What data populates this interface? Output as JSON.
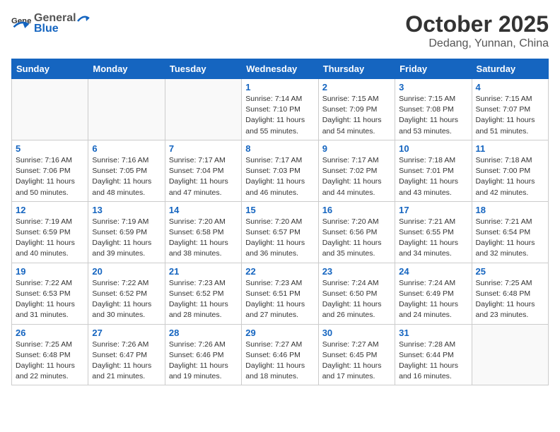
{
  "header": {
    "logo_general": "General",
    "logo_blue": "Blue",
    "title": "October 2025",
    "subtitle": "Dedang, Yunnan, China"
  },
  "weekdays": [
    "Sunday",
    "Monday",
    "Tuesday",
    "Wednesday",
    "Thursday",
    "Friday",
    "Saturday"
  ],
  "weeks": [
    [
      {
        "day": "",
        "sunrise": "",
        "sunset": "",
        "daylight": ""
      },
      {
        "day": "",
        "sunrise": "",
        "sunset": "",
        "daylight": ""
      },
      {
        "day": "",
        "sunrise": "",
        "sunset": "",
        "daylight": ""
      },
      {
        "day": "1",
        "sunrise": "Sunrise: 7:14 AM",
        "sunset": "Sunset: 7:10 PM",
        "daylight": "Daylight: 11 hours and 55 minutes."
      },
      {
        "day": "2",
        "sunrise": "Sunrise: 7:15 AM",
        "sunset": "Sunset: 7:09 PM",
        "daylight": "Daylight: 11 hours and 54 minutes."
      },
      {
        "day": "3",
        "sunrise": "Sunrise: 7:15 AM",
        "sunset": "Sunset: 7:08 PM",
        "daylight": "Daylight: 11 hours and 53 minutes."
      },
      {
        "day": "4",
        "sunrise": "Sunrise: 7:15 AM",
        "sunset": "Sunset: 7:07 PM",
        "daylight": "Daylight: 11 hours and 51 minutes."
      }
    ],
    [
      {
        "day": "5",
        "sunrise": "Sunrise: 7:16 AM",
        "sunset": "Sunset: 7:06 PM",
        "daylight": "Daylight: 11 hours and 50 minutes."
      },
      {
        "day": "6",
        "sunrise": "Sunrise: 7:16 AM",
        "sunset": "Sunset: 7:05 PM",
        "daylight": "Daylight: 11 hours and 48 minutes."
      },
      {
        "day": "7",
        "sunrise": "Sunrise: 7:17 AM",
        "sunset": "Sunset: 7:04 PM",
        "daylight": "Daylight: 11 hours and 47 minutes."
      },
      {
        "day": "8",
        "sunrise": "Sunrise: 7:17 AM",
        "sunset": "Sunset: 7:03 PM",
        "daylight": "Daylight: 11 hours and 46 minutes."
      },
      {
        "day": "9",
        "sunrise": "Sunrise: 7:17 AM",
        "sunset": "Sunset: 7:02 PM",
        "daylight": "Daylight: 11 hours and 44 minutes."
      },
      {
        "day": "10",
        "sunrise": "Sunrise: 7:18 AM",
        "sunset": "Sunset: 7:01 PM",
        "daylight": "Daylight: 11 hours and 43 minutes."
      },
      {
        "day": "11",
        "sunrise": "Sunrise: 7:18 AM",
        "sunset": "Sunset: 7:00 PM",
        "daylight": "Daylight: 11 hours and 42 minutes."
      }
    ],
    [
      {
        "day": "12",
        "sunrise": "Sunrise: 7:19 AM",
        "sunset": "Sunset: 6:59 PM",
        "daylight": "Daylight: 11 hours and 40 minutes."
      },
      {
        "day": "13",
        "sunrise": "Sunrise: 7:19 AM",
        "sunset": "Sunset: 6:59 PM",
        "daylight": "Daylight: 11 hours and 39 minutes."
      },
      {
        "day": "14",
        "sunrise": "Sunrise: 7:20 AM",
        "sunset": "Sunset: 6:58 PM",
        "daylight": "Daylight: 11 hours and 38 minutes."
      },
      {
        "day": "15",
        "sunrise": "Sunrise: 7:20 AM",
        "sunset": "Sunset: 6:57 PM",
        "daylight": "Daylight: 11 hours and 36 minutes."
      },
      {
        "day": "16",
        "sunrise": "Sunrise: 7:20 AM",
        "sunset": "Sunset: 6:56 PM",
        "daylight": "Daylight: 11 hours and 35 minutes."
      },
      {
        "day": "17",
        "sunrise": "Sunrise: 7:21 AM",
        "sunset": "Sunset: 6:55 PM",
        "daylight": "Daylight: 11 hours and 34 minutes."
      },
      {
        "day": "18",
        "sunrise": "Sunrise: 7:21 AM",
        "sunset": "Sunset: 6:54 PM",
        "daylight": "Daylight: 11 hours and 32 minutes."
      }
    ],
    [
      {
        "day": "19",
        "sunrise": "Sunrise: 7:22 AM",
        "sunset": "Sunset: 6:53 PM",
        "daylight": "Daylight: 11 hours and 31 minutes."
      },
      {
        "day": "20",
        "sunrise": "Sunrise: 7:22 AM",
        "sunset": "Sunset: 6:52 PM",
        "daylight": "Daylight: 11 hours and 30 minutes."
      },
      {
        "day": "21",
        "sunrise": "Sunrise: 7:23 AM",
        "sunset": "Sunset: 6:52 PM",
        "daylight": "Daylight: 11 hours and 28 minutes."
      },
      {
        "day": "22",
        "sunrise": "Sunrise: 7:23 AM",
        "sunset": "Sunset: 6:51 PM",
        "daylight": "Daylight: 11 hours and 27 minutes."
      },
      {
        "day": "23",
        "sunrise": "Sunrise: 7:24 AM",
        "sunset": "Sunset: 6:50 PM",
        "daylight": "Daylight: 11 hours and 26 minutes."
      },
      {
        "day": "24",
        "sunrise": "Sunrise: 7:24 AM",
        "sunset": "Sunset: 6:49 PM",
        "daylight": "Daylight: 11 hours and 24 minutes."
      },
      {
        "day": "25",
        "sunrise": "Sunrise: 7:25 AM",
        "sunset": "Sunset: 6:48 PM",
        "daylight": "Daylight: 11 hours and 23 minutes."
      }
    ],
    [
      {
        "day": "26",
        "sunrise": "Sunrise: 7:25 AM",
        "sunset": "Sunset: 6:48 PM",
        "daylight": "Daylight: 11 hours and 22 minutes."
      },
      {
        "day": "27",
        "sunrise": "Sunrise: 7:26 AM",
        "sunset": "Sunset: 6:47 PM",
        "daylight": "Daylight: 11 hours and 21 minutes."
      },
      {
        "day": "28",
        "sunrise": "Sunrise: 7:26 AM",
        "sunset": "Sunset: 6:46 PM",
        "daylight": "Daylight: 11 hours and 19 minutes."
      },
      {
        "day": "29",
        "sunrise": "Sunrise: 7:27 AM",
        "sunset": "Sunset: 6:46 PM",
        "daylight": "Daylight: 11 hours and 18 minutes."
      },
      {
        "day": "30",
        "sunrise": "Sunrise: 7:27 AM",
        "sunset": "Sunset: 6:45 PM",
        "daylight": "Daylight: 11 hours and 17 minutes."
      },
      {
        "day": "31",
        "sunrise": "Sunrise: 7:28 AM",
        "sunset": "Sunset: 6:44 PM",
        "daylight": "Daylight: 11 hours and 16 minutes."
      },
      {
        "day": "",
        "sunrise": "",
        "sunset": "",
        "daylight": ""
      }
    ]
  ]
}
